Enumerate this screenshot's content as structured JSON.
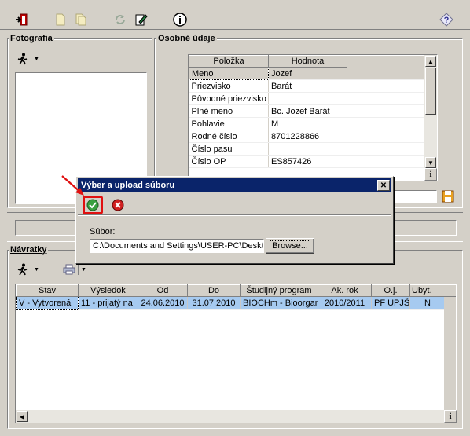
{
  "toolbar": {
    "exit_icon": "exit-icon",
    "new_icon": "new-doc-icon",
    "copy_icon": "copy-doc-icon",
    "refresh_icon": "refresh-icon",
    "edit_icon": "edit-icon",
    "info_icon": "info-icon",
    "help_icon": "help-icon"
  },
  "photo_panel": {
    "title": "Fotografia"
  },
  "personal_panel": {
    "title": "Osobné údaje",
    "columns": [
      "Položka",
      "Hodnota"
    ],
    "rows": [
      {
        "item": "Meno",
        "value": "Jozef"
      },
      {
        "item": "Priezvisko",
        "value": "Barát"
      },
      {
        "item": "Pôvodné priezvisko",
        "value": ""
      },
      {
        "item": "Plné meno",
        "value": "Bc. Jozef Barát"
      },
      {
        "item": "Pohlavie",
        "value": "M"
      },
      {
        "item": "Rodné číslo",
        "value": "8701228866"
      },
      {
        "item": "Číslo pasu",
        "value": ""
      },
      {
        "item": "Číslo OP",
        "value": "ES857426"
      }
    ],
    "info_label": "i"
  },
  "returns_panel": {
    "title": "Návratky",
    "columns": [
      "Stav",
      "Výsledok",
      "Od",
      "Do",
      "Študijný program",
      "Ak. rok",
      "O.j.",
      "Ubyt."
    ],
    "rows": [
      [
        "V - Vytvorená",
        "11 - prijatý na",
        "24.06.2010",
        "31.07.2010",
        "BIOCHm - Bioorgan",
        "2010/2011",
        "PF UPJŠ",
        "N"
      ]
    ],
    "info_label": "i"
  },
  "dialog": {
    "title": "Výber a upload súboru",
    "close_label": "✕",
    "file_label": "Súbor:",
    "file_value": "C:\\Documents and Settings\\USER-PC\\Deskt",
    "browse_label": "Browse..."
  },
  "colors": {
    "face": "#d4d0c8",
    "title_bar": "#0a246a",
    "selection": "#a6caf0",
    "highlight_box": "#e01010"
  }
}
